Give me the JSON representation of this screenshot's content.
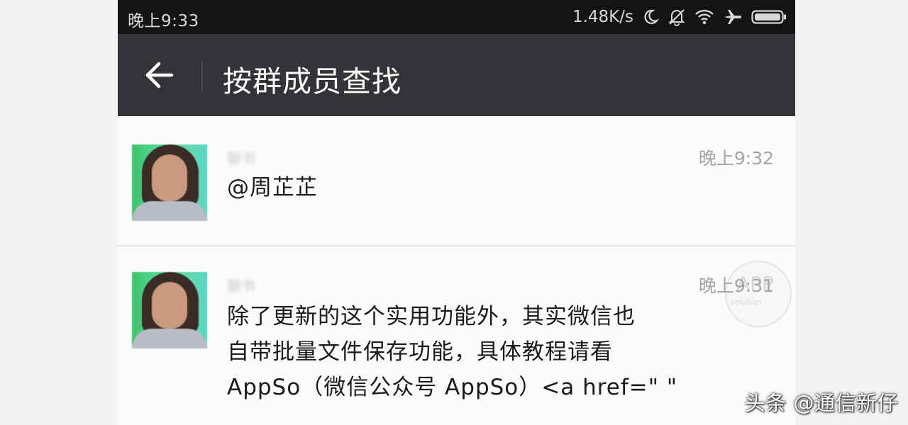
{
  "status_bar": {
    "time": "晚上9:33",
    "network_speed": "1.48K/s",
    "icons": [
      "moon-icon",
      "bell-muted-icon",
      "wifi-icon",
      "airplane-icon",
      "battery-icon"
    ]
  },
  "app_bar": {
    "back_icon": "back-arrow-icon",
    "title": "按群成员查找"
  },
  "messages": [
    {
      "sender": "聊书",
      "timestamp": "晚上9:32",
      "text": "@周芷芷"
    },
    {
      "sender": "聊书",
      "timestamp": "晚上9:31",
      "lines": [
        "除了更新的这个实用功能外，其实微信也",
        "自带批量文件保存功能，具体教程请看",
        "AppSo（微信公众号 AppSo）<a href=\" \""
      ]
    }
  ],
  "watermark": {
    "big": "APP",
    "small": "solution"
  },
  "source_credit": "头条 @通信新仔",
  "colors": {
    "status_bar_bg": "#141414",
    "app_bar_bg": "#333437",
    "list_bg": "#fbfbfb",
    "timestamp": "#a3a3a3",
    "message_text": "#1a1a1a"
  }
}
